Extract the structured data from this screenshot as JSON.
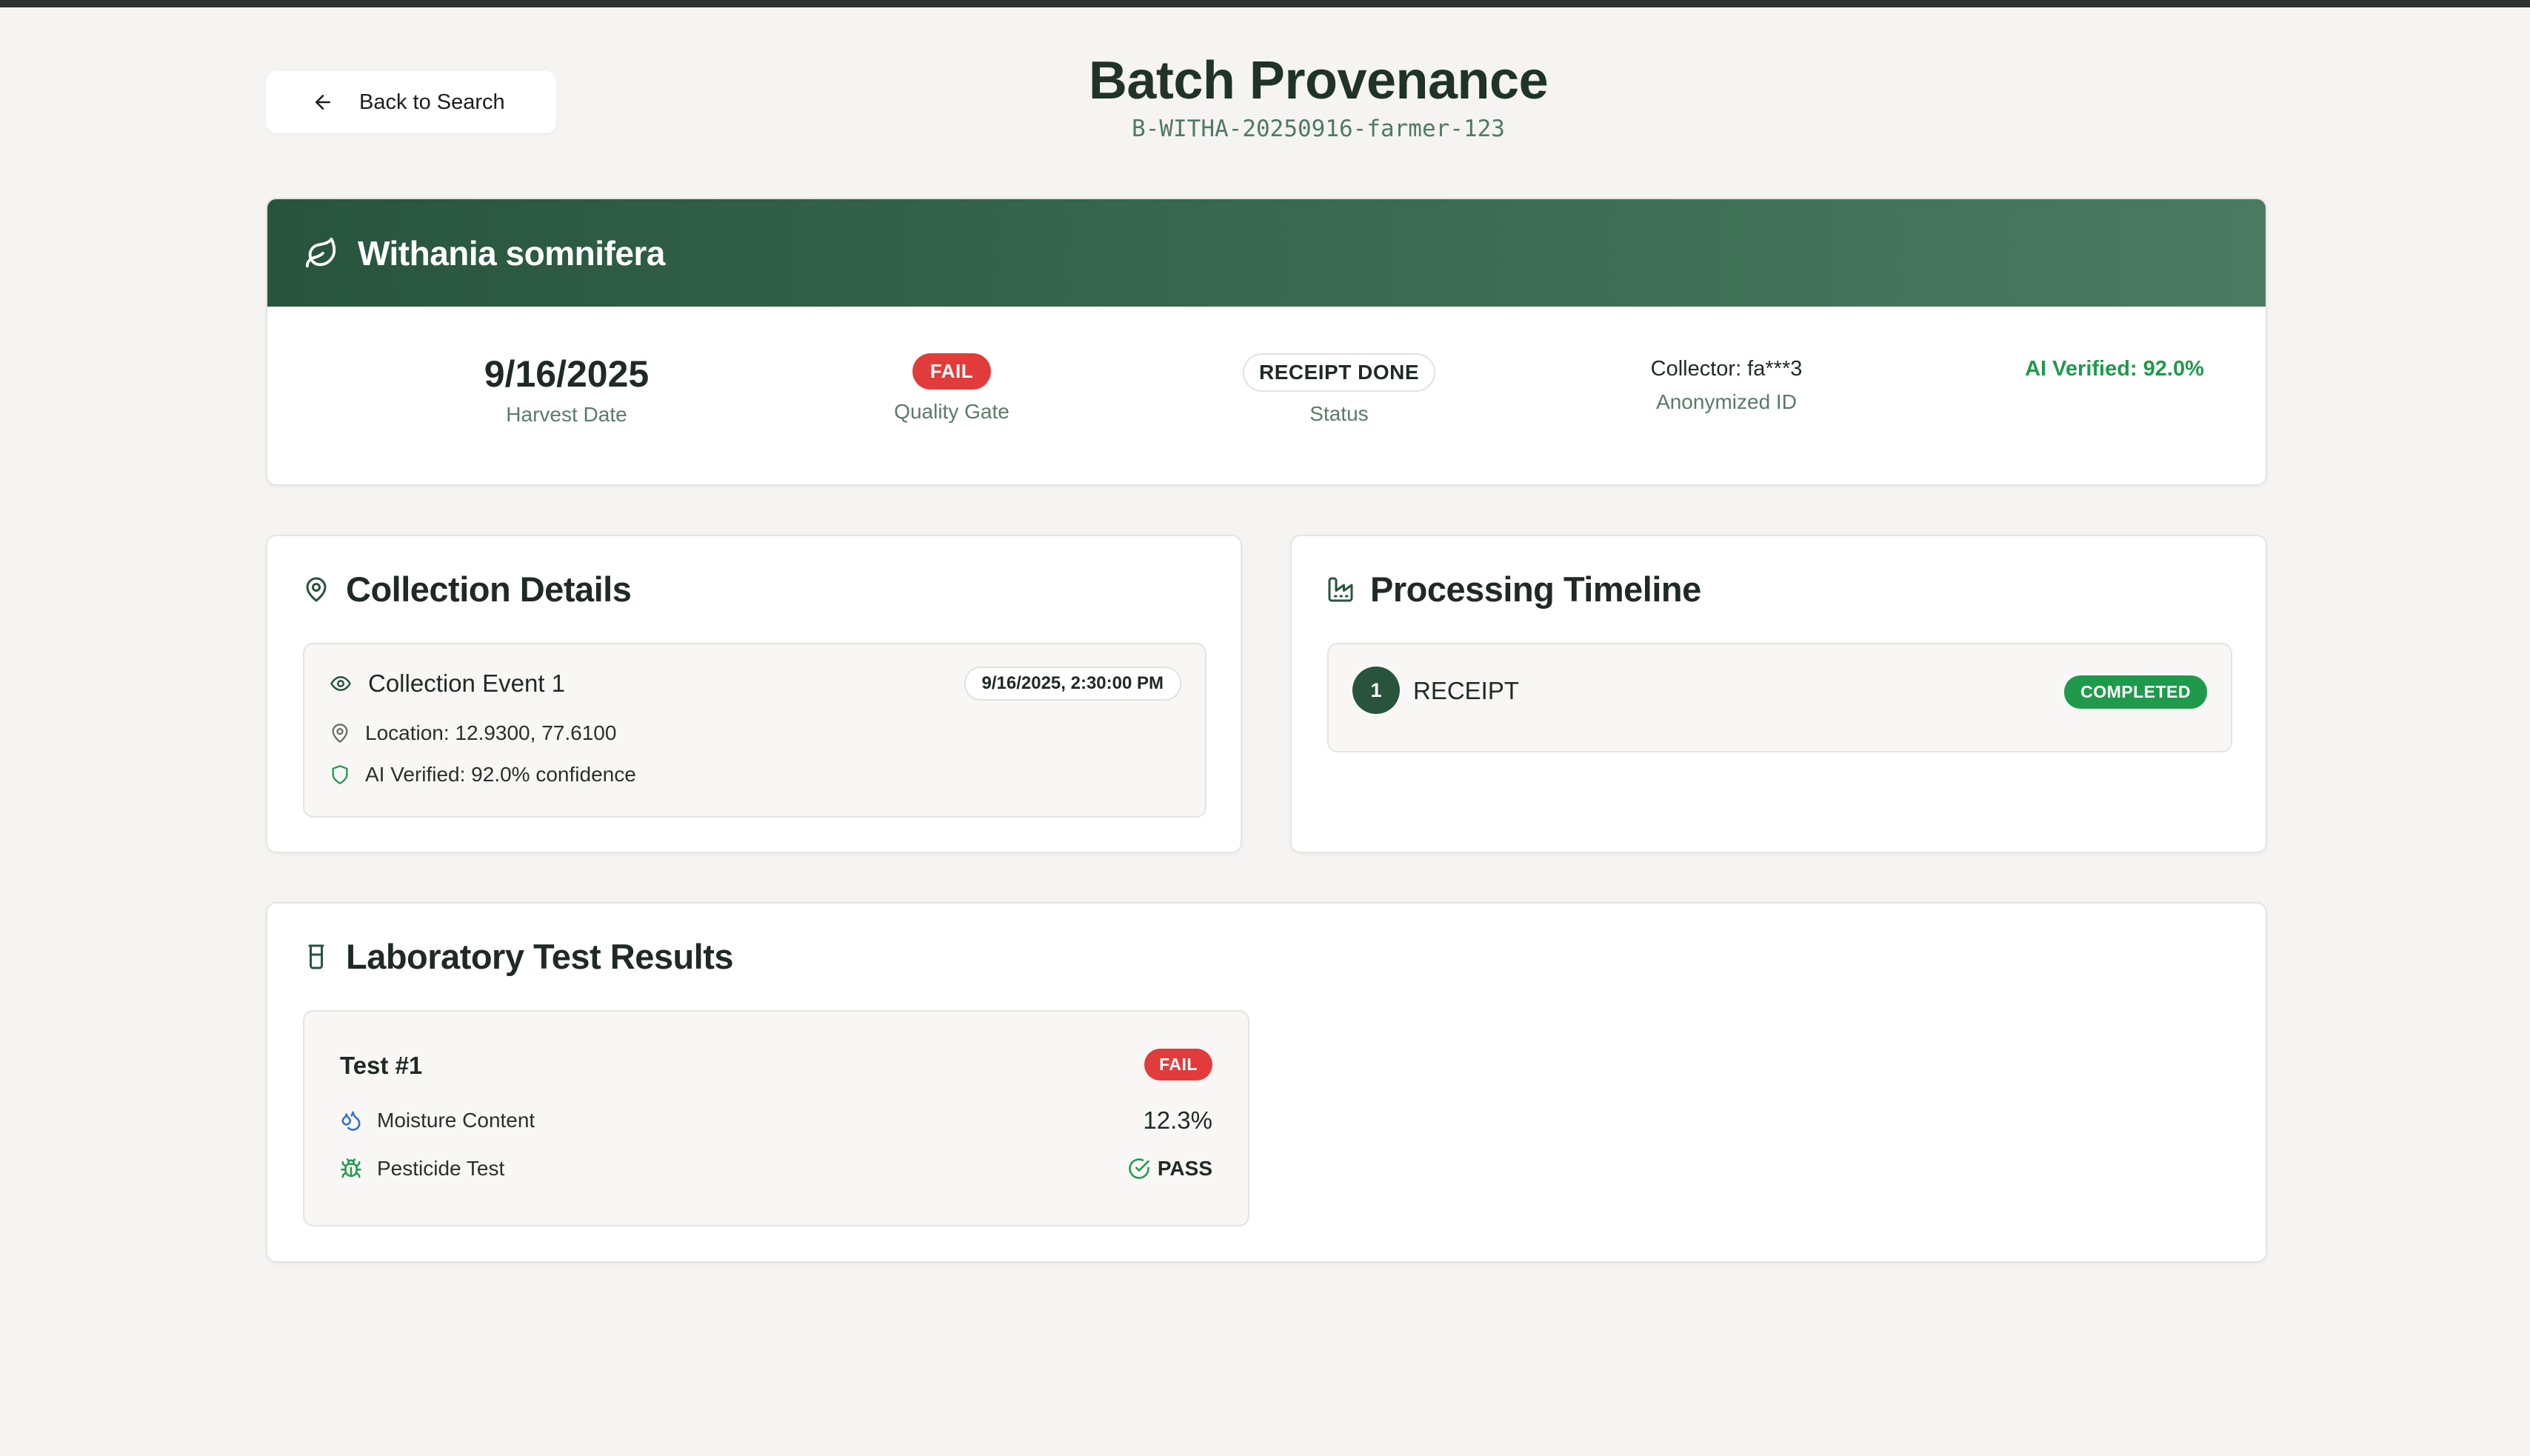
{
  "header": {
    "back_label": "Back to Search",
    "title": "Batch Provenance",
    "batch_id": "B-WITHA-20250916-farmer-123"
  },
  "summary": {
    "species": "Withania somnifera",
    "harvest_date": "9/16/2025",
    "harvest_date_label": "Harvest Date",
    "quality_gate_value": "FAIL",
    "quality_gate_label": "Quality Gate",
    "status_value": "RECEIPT DONE",
    "status_label": "Status",
    "collector_value": "Collector: fa***3",
    "collector_label": "Anonymized ID",
    "ai_verified": "AI Verified: 92.0%"
  },
  "collection": {
    "title": "Collection Details",
    "event_title": "Collection Event 1",
    "event_time": "9/16/2025, 2:30:00 PM",
    "location": "Location: 12.9300, 77.6100",
    "ai_verified": "AI Verified: 92.0% confidence"
  },
  "processing": {
    "title": "Processing Timeline",
    "steps": [
      {
        "number": "1",
        "label": "RECEIPT",
        "status": "COMPLETED"
      }
    ]
  },
  "lab": {
    "title": "Laboratory Test Results",
    "tests": [
      {
        "title": "Test #1",
        "result": "FAIL",
        "moisture_label": "Moisture Content",
        "moisture_value": "12.3%",
        "pesticide_label": "Pesticide Test",
        "pesticide_value": "PASS"
      }
    ]
  },
  "colors": {
    "brand_green": "#28543d",
    "success_green": "#1f9a4b",
    "fail_red": "#e23b3b",
    "background": "#f5f4f2"
  },
  "icons": {
    "back": "arrow-left-icon",
    "species": "leaf-icon",
    "collection": "map-pin-icon",
    "event": "eye-icon",
    "location": "map-pin-icon",
    "ai": "shield-icon",
    "processing": "factory-icon",
    "lab": "beaker-icon",
    "moisture": "droplets-icon",
    "pesticide": "bug-icon",
    "pass": "check-circle-icon"
  }
}
